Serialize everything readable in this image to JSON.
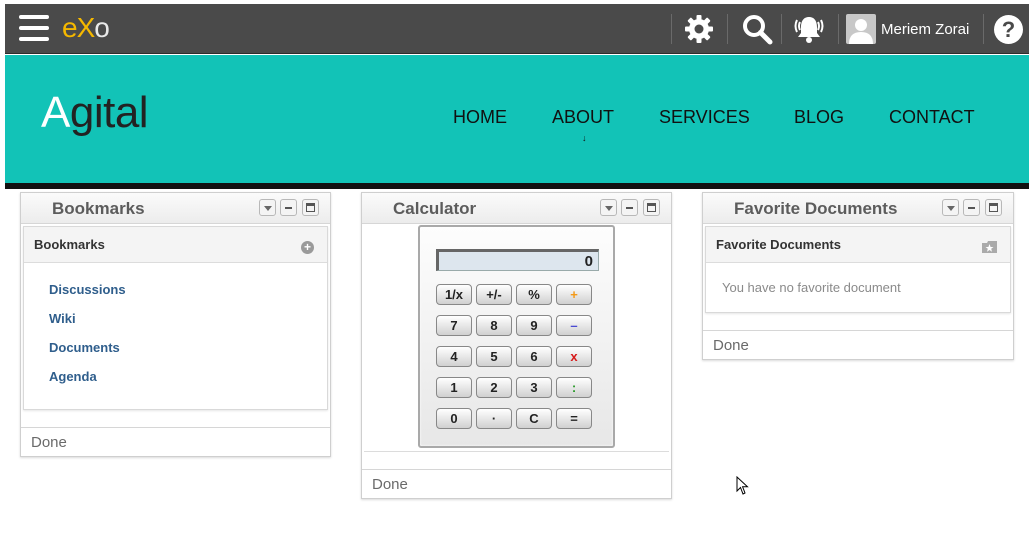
{
  "topbar": {
    "logo_left": "eX",
    "logo_right": "o",
    "user_name": "Meriem Zorai",
    "help_label": "?"
  },
  "banner": {
    "brand_first": "A",
    "brand_rest": "gital",
    "nav": [
      "HOME",
      "ABOUT",
      "SERVICES",
      "BLOG",
      "CONTACT"
    ],
    "about_caret": "↓"
  },
  "bookmarks": {
    "title": "Bookmarks",
    "inner_title": "Bookmarks",
    "links": [
      "Discussions",
      "Wiki",
      "Documents",
      "Agenda"
    ],
    "done": "Done"
  },
  "calculator": {
    "title": "Calculator",
    "display": "0",
    "keys": [
      [
        "1/x",
        "+/-",
        "%",
        "+"
      ],
      [
        "7",
        "8",
        "9",
        "–"
      ],
      [
        "4",
        "5",
        "6",
        "x"
      ],
      [
        "1",
        "2",
        "3",
        ":"
      ],
      [
        "0",
        "·",
        "C",
        "="
      ]
    ],
    "done": "Done"
  },
  "favorites": {
    "title": "Favorite Documents",
    "inner_title": "Favorite Documents",
    "empty_text": "You have no favorite document",
    "done": "Done"
  },
  "colors": {
    "banner": "#12c3b7",
    "topbar": "#4a4a4a",
    "logo": "#f5b800",
    "link": "#2f5e8c"
  }
}
